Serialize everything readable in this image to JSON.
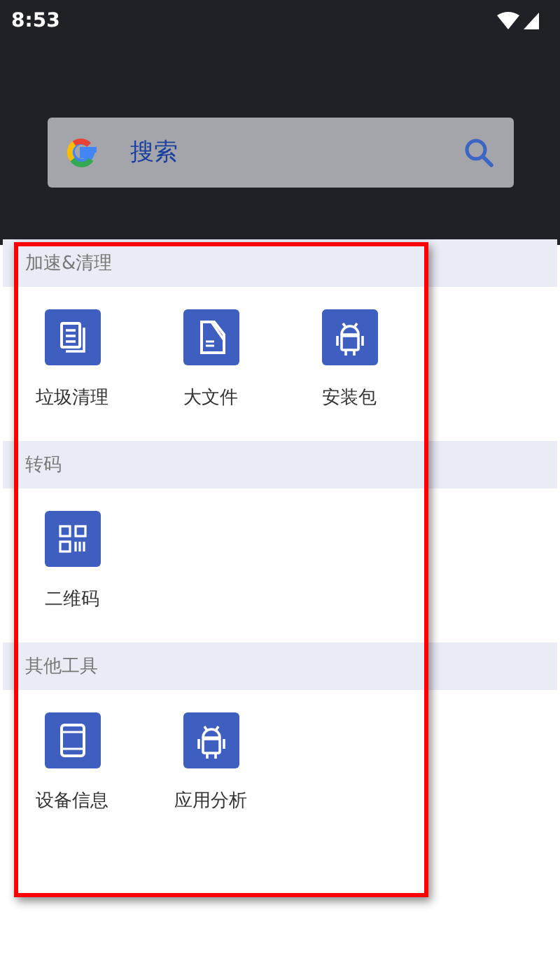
{
  "status_bar": {
    "time": "8:53"
  },
  "search": {
    "placeholder": "搜索"
  },
  "sections": [
    {
      "title": "加速&清理",
      "items": [
        {
          "label": "垃圾清理"
        },
        {
          "label": "大文件"
        },
        {
          "label": "安装包"
        }
      ]
    },
    {
      "title": "转码",
      "items": [
        {
          "label": "二维码"
        }
      ]
    },
    {
      "title": "其他工具",
      "items": [
        {
          "label": "设备信息"
        },
        {
          "label": "应用分析"
        }
      ]
    }
  ],
  "highlight": {
    "kind": "frame"
  }
}
